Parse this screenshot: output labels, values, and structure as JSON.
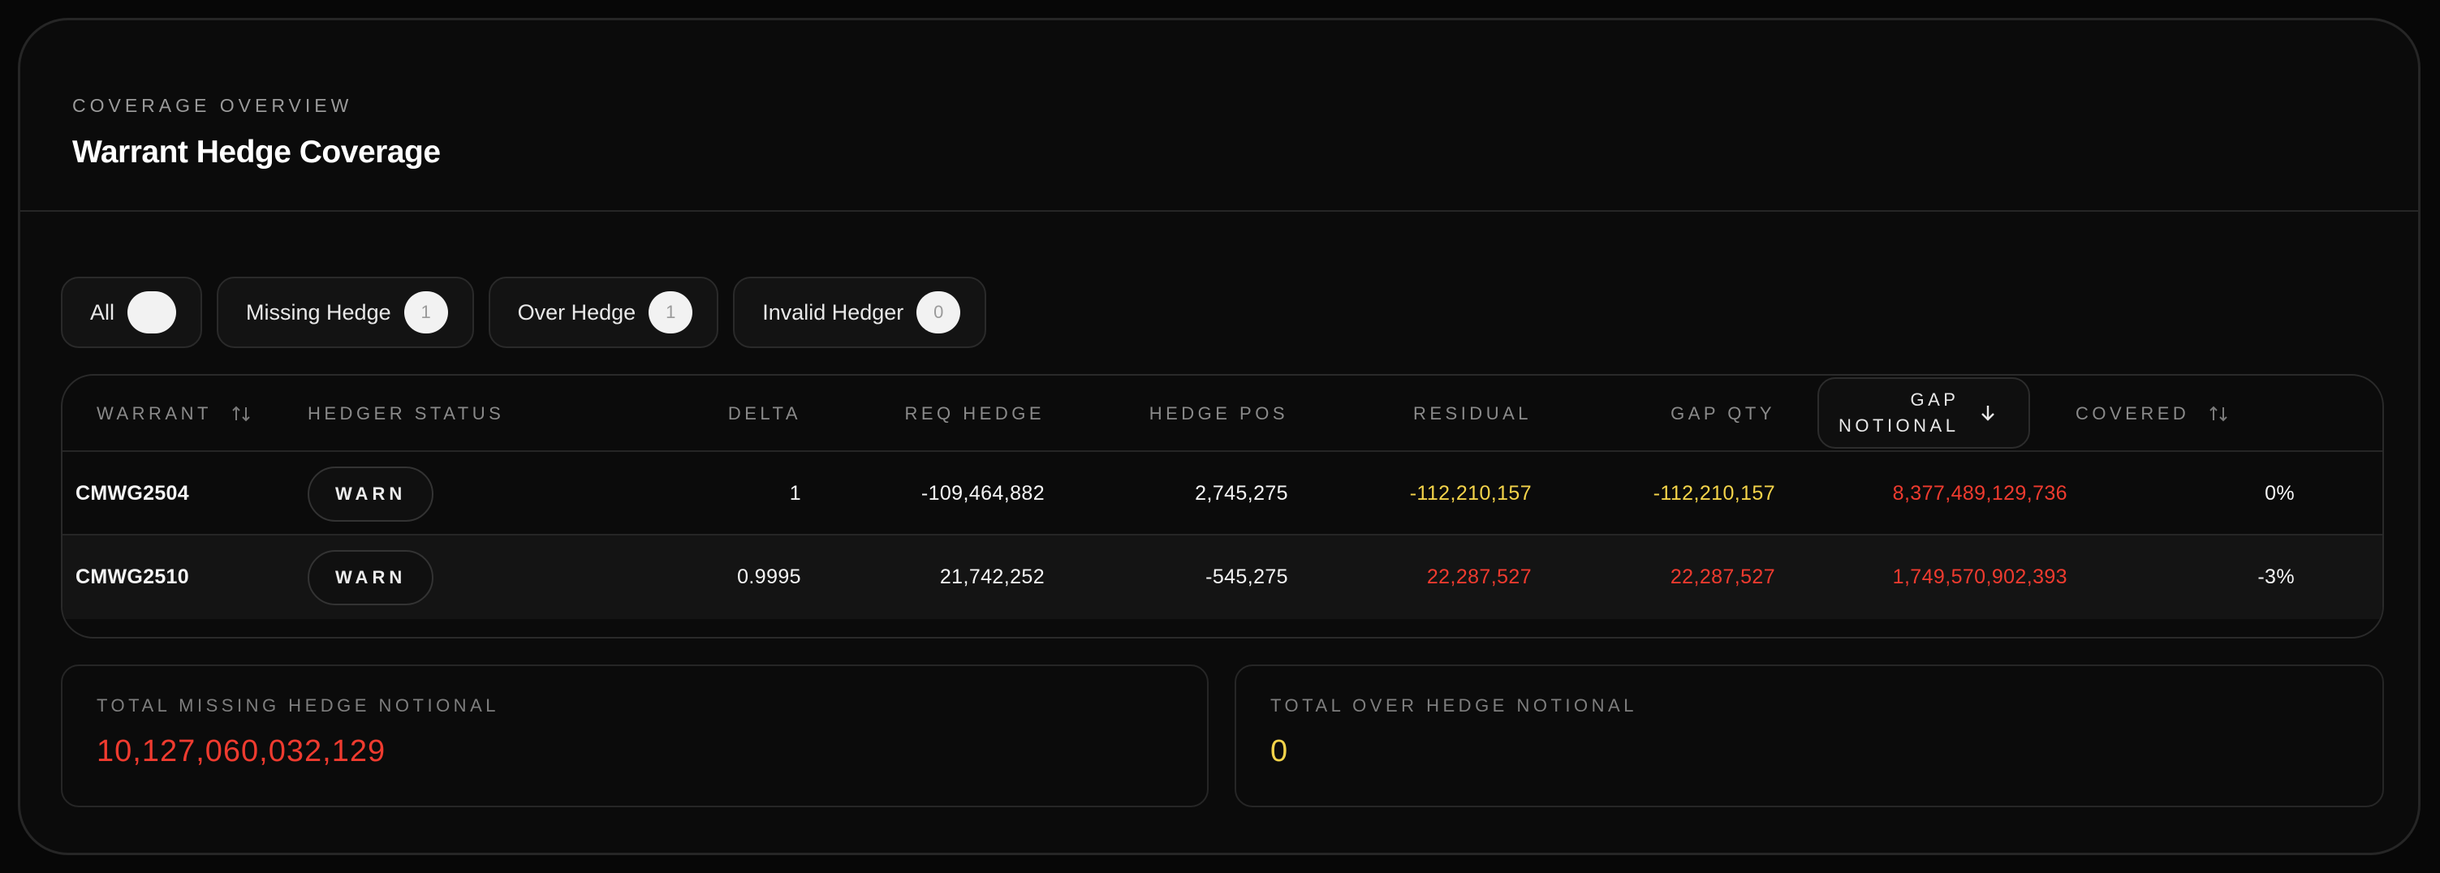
{
  "header": {
    "eyebrow": "COVERAGE OVERVIEW",
    "title": "Warrant Hedge Coverage"
  },
  "filters": [
    {
      "label": "All",
      "count": ""
    },
    {
      "label": "Missing Hedge",
      "count": "1"
    },
    {
      "label": "Over Hedge",
      "count": "1"
    },
    {
      "label": "Invalid Hedger",
      "count": "0"
    }
  ],
  "table": {
    "columns": {
      "warrant": "WARRANT",
      "hedger_status": "HEDGER STATUS",
      "delta": "DELTA",
      "req_hedge": "REQ HEDGE",
      "hedge_pos": "HEDGE POS",
      "residual": "RESIDUAL",
      "gap_qty": "GAP QTY",
      "gap_notional_1": "GAP",
      "gap_notional_2": "NOTIONAL",
      "covered": "COVERED"
    },
    "rows": [
      {
        "warrant": "CMWG2504",
        "status": "WARN",
        "delta": "1",
        "req_hedge": "-109,464,882",
        "hedge_pos": "2,745,275",
        "residual": "-112,210,157",
        "gap_qty": "-112,210,157",
        "gap_notional": "8,377,489,129,736",
        "covered": "0%"
      },
      {
        "warrant": "CMWG2510",
        "status": "WARN",
        "delta": "0.9995",
        "req_hedge": "21,742,252",
        "hedge_pos": "-545,275",
        "residual": "22,287,527",
        "gap_qty": "22,287,527",
        "gap_notional": "1,749,570,902,393",
        "covered": "-3%"
      }
    ]
  },
  "summary": {
    "missing_label": "TOTAL MISSING HEDGE NOTIONAL",
    "missing_value": "10,127,060,032,129",
    "over_label": "TOTAL OVER HEDGE NOTIONAL",
    "over_value": "0"
  },
  "colors": {
    "warning_yellow": "#f3d34a",
    "error_red": "#ef3b2f",
    "background": "#0b0b0b"
  },
  "icons": {
    "sort": "sort-updown-icon",
    "sort_active": "arrow-down-icon"
  }
}
